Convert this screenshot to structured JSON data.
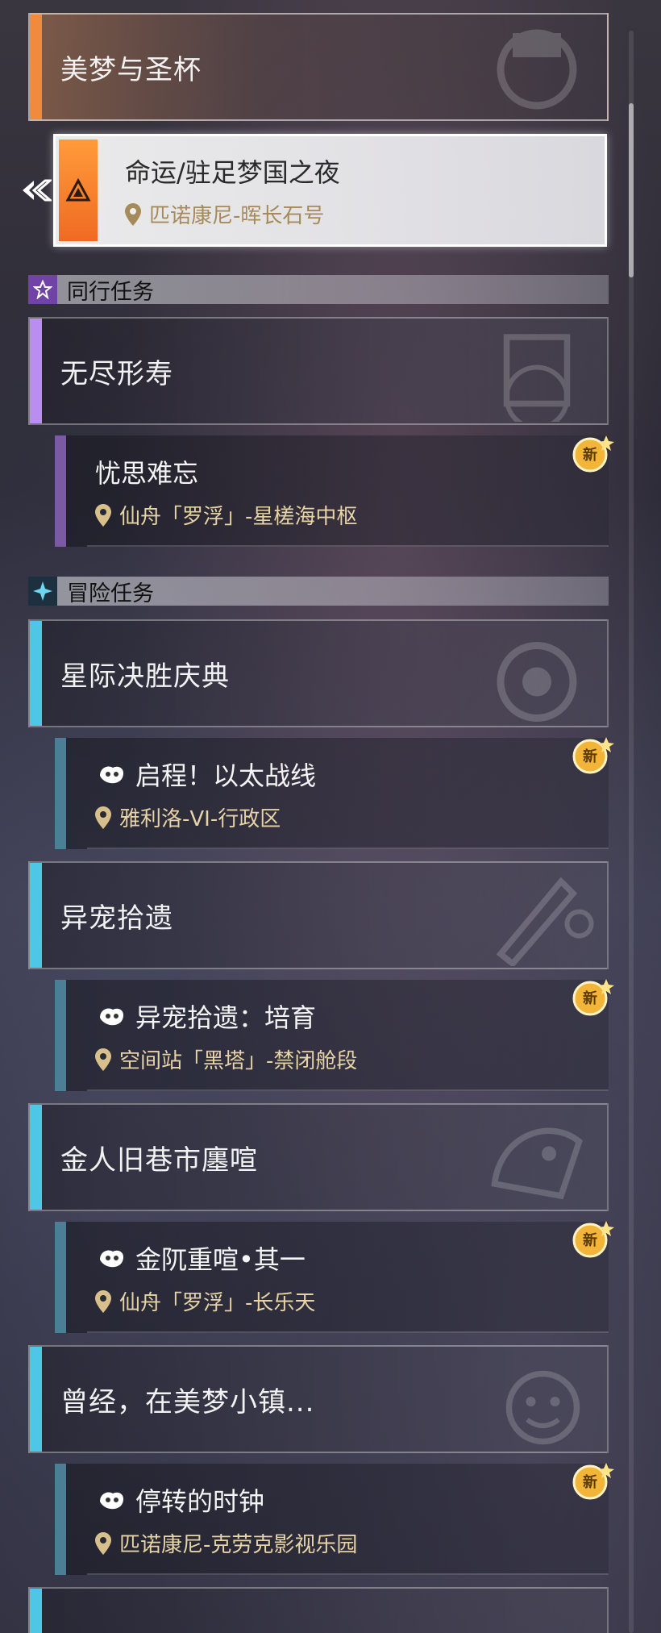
{
  "main_group": {
    "title": "美梦与圣杯"
  },
  "selected_quest": {
    "title": "命运/驻足梦国之夜",
    "location": "匹诺康尼-晖长石号"
  },
  "sections": {
    "companion": {
      "label": "同行任务"
    },
    "adventure": {
      "label": "冒险任务"
    }
  },
  "groups": [
    {
      "title": "无尽形寿",
      "quest": {
        "title": "忧思难忘",
        "location": "仙舟「罗浮」-星槎海中枢",
        "badge": "新"
      }
    },
    {
      "title": "星际决胜庆典",
      "quest": {
        "title": "启程！以太战线",
        "location": "雅利洛-VI-行政区",
        "badge": "新"
      }
    },
    {
      "title": "异宠拾遗",
      "quest": {
        "title": "异宠拾遗：培育",
        "location": "空间站「黑塔」-禁闭舱段",
        "badge": "新"
      }
    },
    {
      "title": "金人旧巷市廛喧",
      "quest": {
        "title": "金阢重喧•其一",
        "location": "仙舟「罗浮」-长乐天",
        "badge": "新"
      }
    },
    {
      "title": "曾经，在美梦小镇...",
      "quest": {
        "title": "停转的时钟",
        "location": "匹诺康尼-克劳克影视乐园",
        "badge": "新"
      }
    }
  ],
  "colors": {
    "trailblaze_accent": "#f08a3c",
    "companion_accent": "#b98ef0",
    "adventure_accent": "#4fc6e6",
    "location_text": "#e6d3a6",
    "badge_gold": "#f2b53a"
  },
  "icons": [
    "selected-arrow-icon",
    "trailblaze-quest-icon",
    "location-pin-icon",
    "star-icon",
    "diamond-star-icon",
    "pet-icon",
    "new-badge-icon"
  ]
}
